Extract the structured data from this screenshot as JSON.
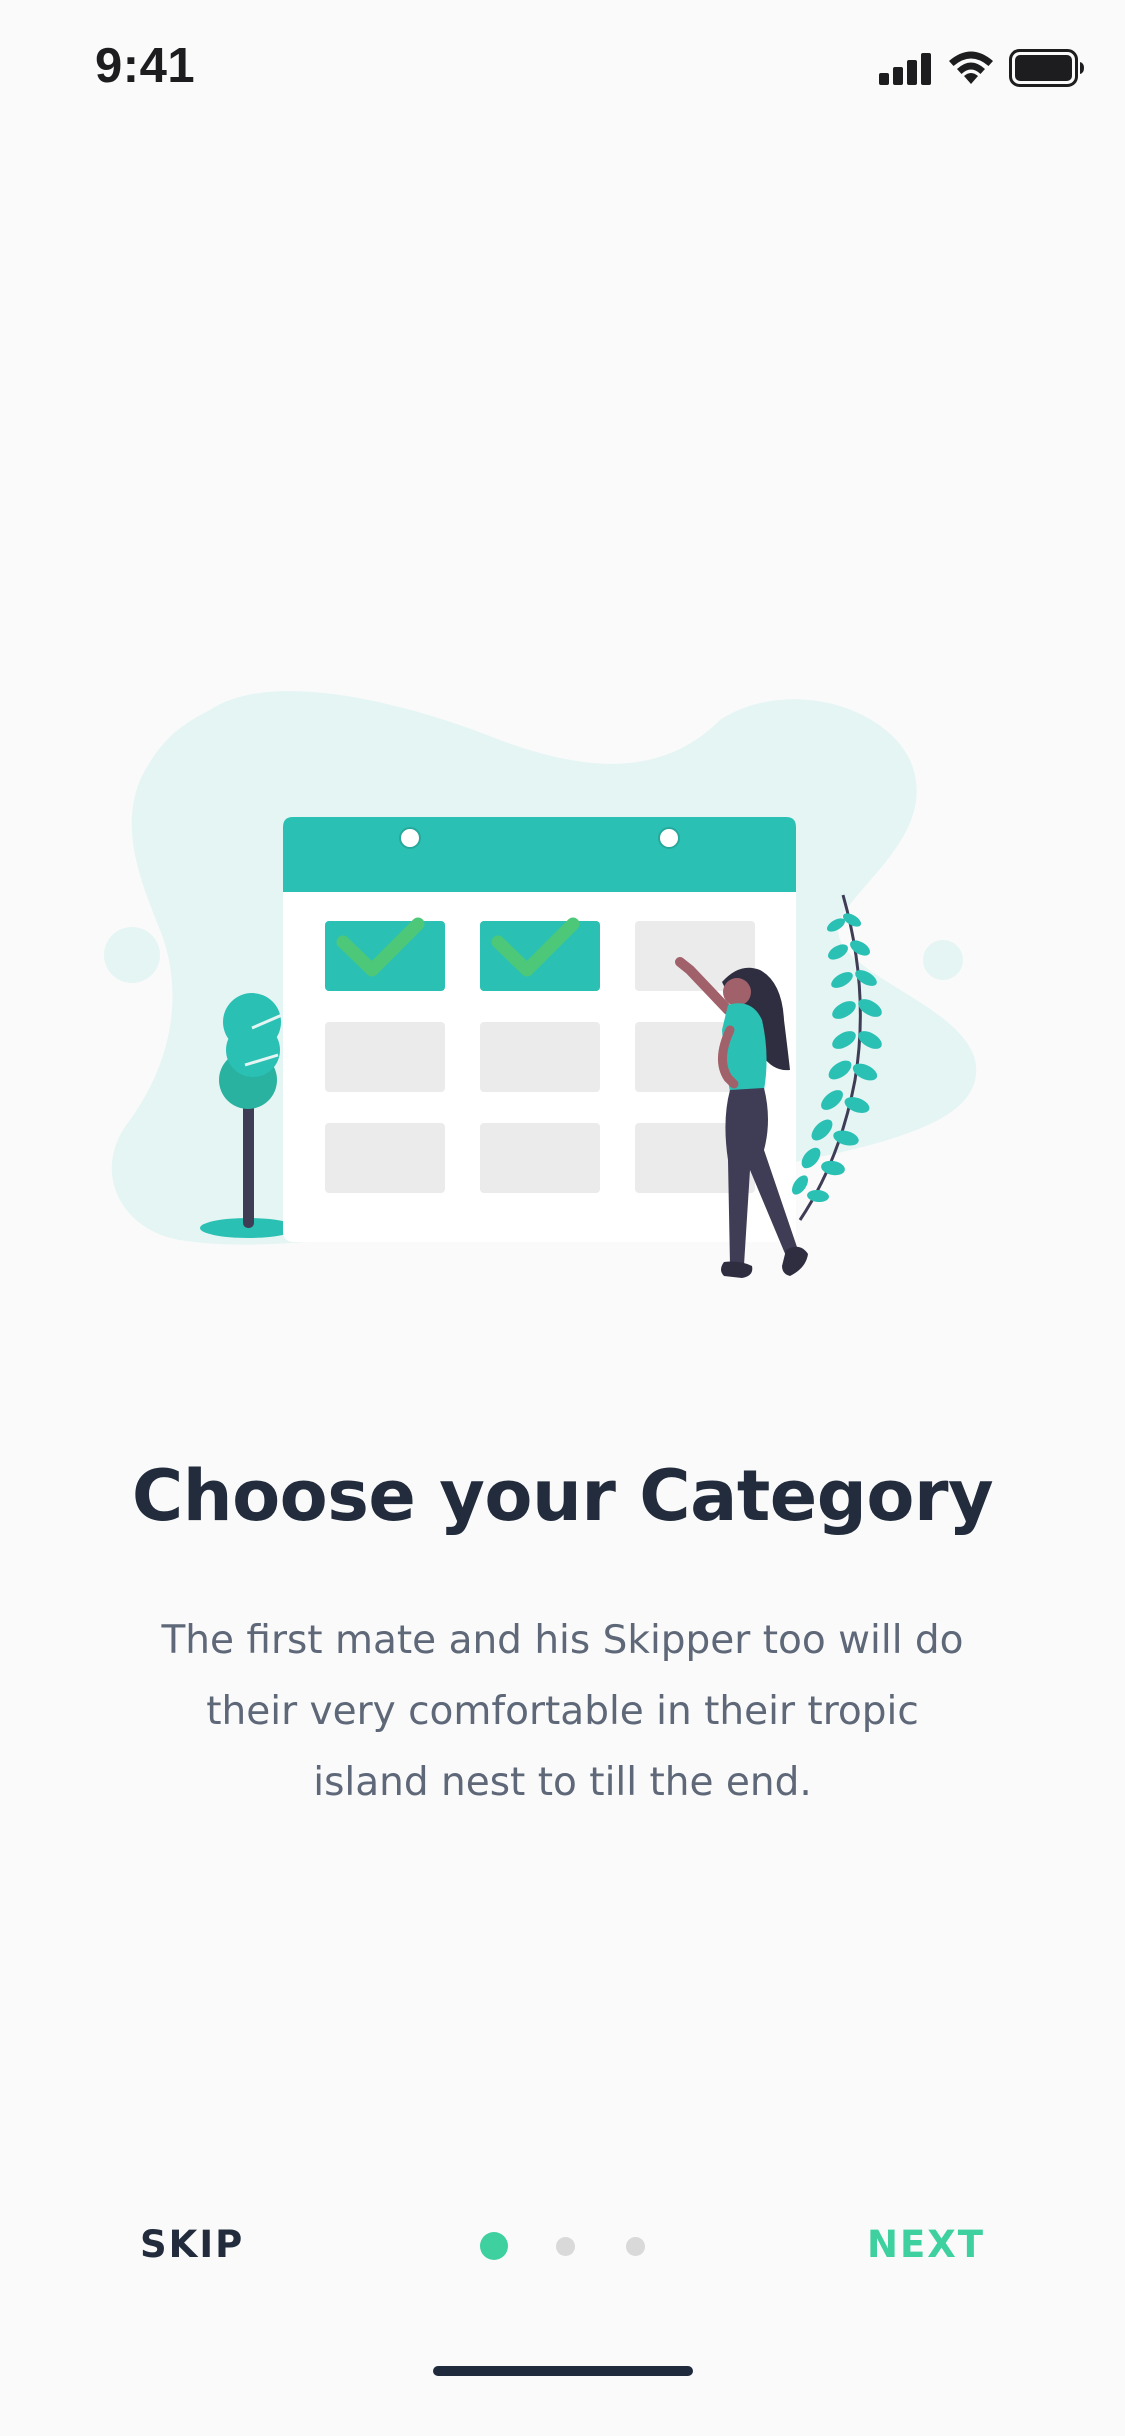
{
  "status_bar": {
    "time": "9:41",
    "icons": [
      "cellular-signal-icon",
      "wifi-icon",
      "battery-icon"
    ]
  },
  "illustration": {
    "name": "calendar-checklist-illustration",
    "checked_boxes": 2,
    "total_boxes": 9
  },
  "onboarding": {
    "title": "Choose your Category",
    "description": "The first mate and his Skipper too will do their very comfortable in their tropic island nest to till the end."
  },
  "navigation": {
    "skip_label": "SKIP",
    "next_label": "NEXT",
    "page_count": 3,
    "current_page": 1
  },
  "colors": {
    "accent": "#3FD0A0",
    "teal": "#2BC0B4",
    "title": "#222C3C",
    "body_text": "#5E6878",
    "background": "#FAFAFA"
  }
}
